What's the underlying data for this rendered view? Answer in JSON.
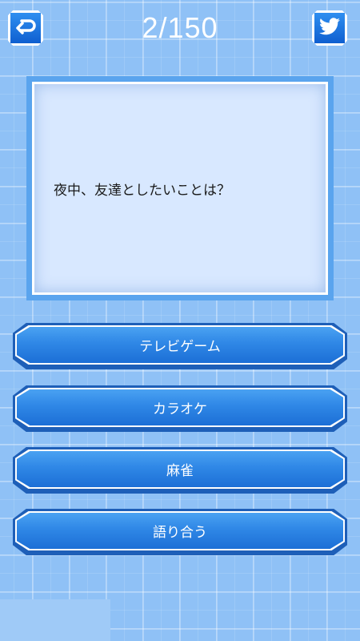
{
  "header": {
    "back_icon": "back-arrow-icon",
    "counter": "2/150",
    "twitter_icon": "twitter-bird-icon"
  },
  "question": {
    "text": "夜中、友達としたいことは？"
  },
  "answers": [
    {
      "label": "テレビゲーム"
    },
    {
      "label": "カラオケ"
    },
    {
      "label": "麻雀"
    },
    {
      "label": "語り合う"
    }
  ],
  "colors": {
    "background": "#8fc1f6",
    "button": "#2f87e6",
    "question_box": "#d8e8ff"
  }
}
